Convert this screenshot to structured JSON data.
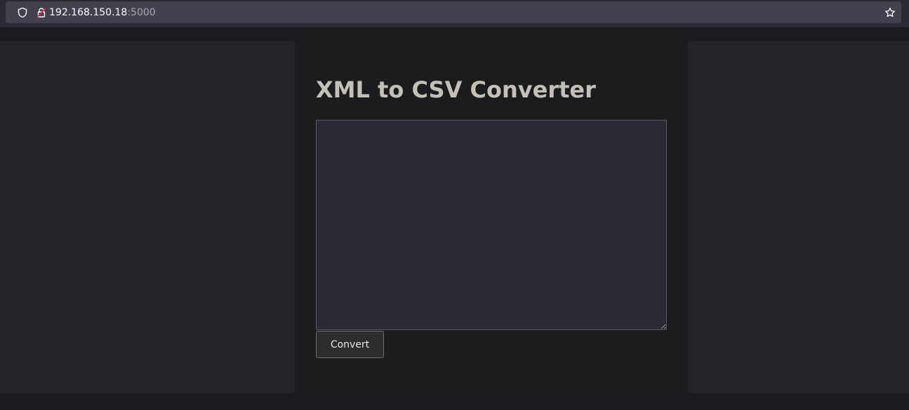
{
  "browser": {
    "url_host": "192.168.150.18",
    "url_port": ":5000"
  },
  "page": {
    "title": "XML to CSV Converter",
    "textarea_value": "",
    "convert_label": "Convert"
  },
  "colors": {
    "page_background": "#1b1c1e",
    "side_panels": "#232427",
    "title_text": "#c4c0b8",
    "textarea_background": "#2b2a35"
  },
  "icons": {
    "site_info": "shield-icon",
    "insecure": "lock-icon",
    "bookmark": "star-icon"
  }
}
